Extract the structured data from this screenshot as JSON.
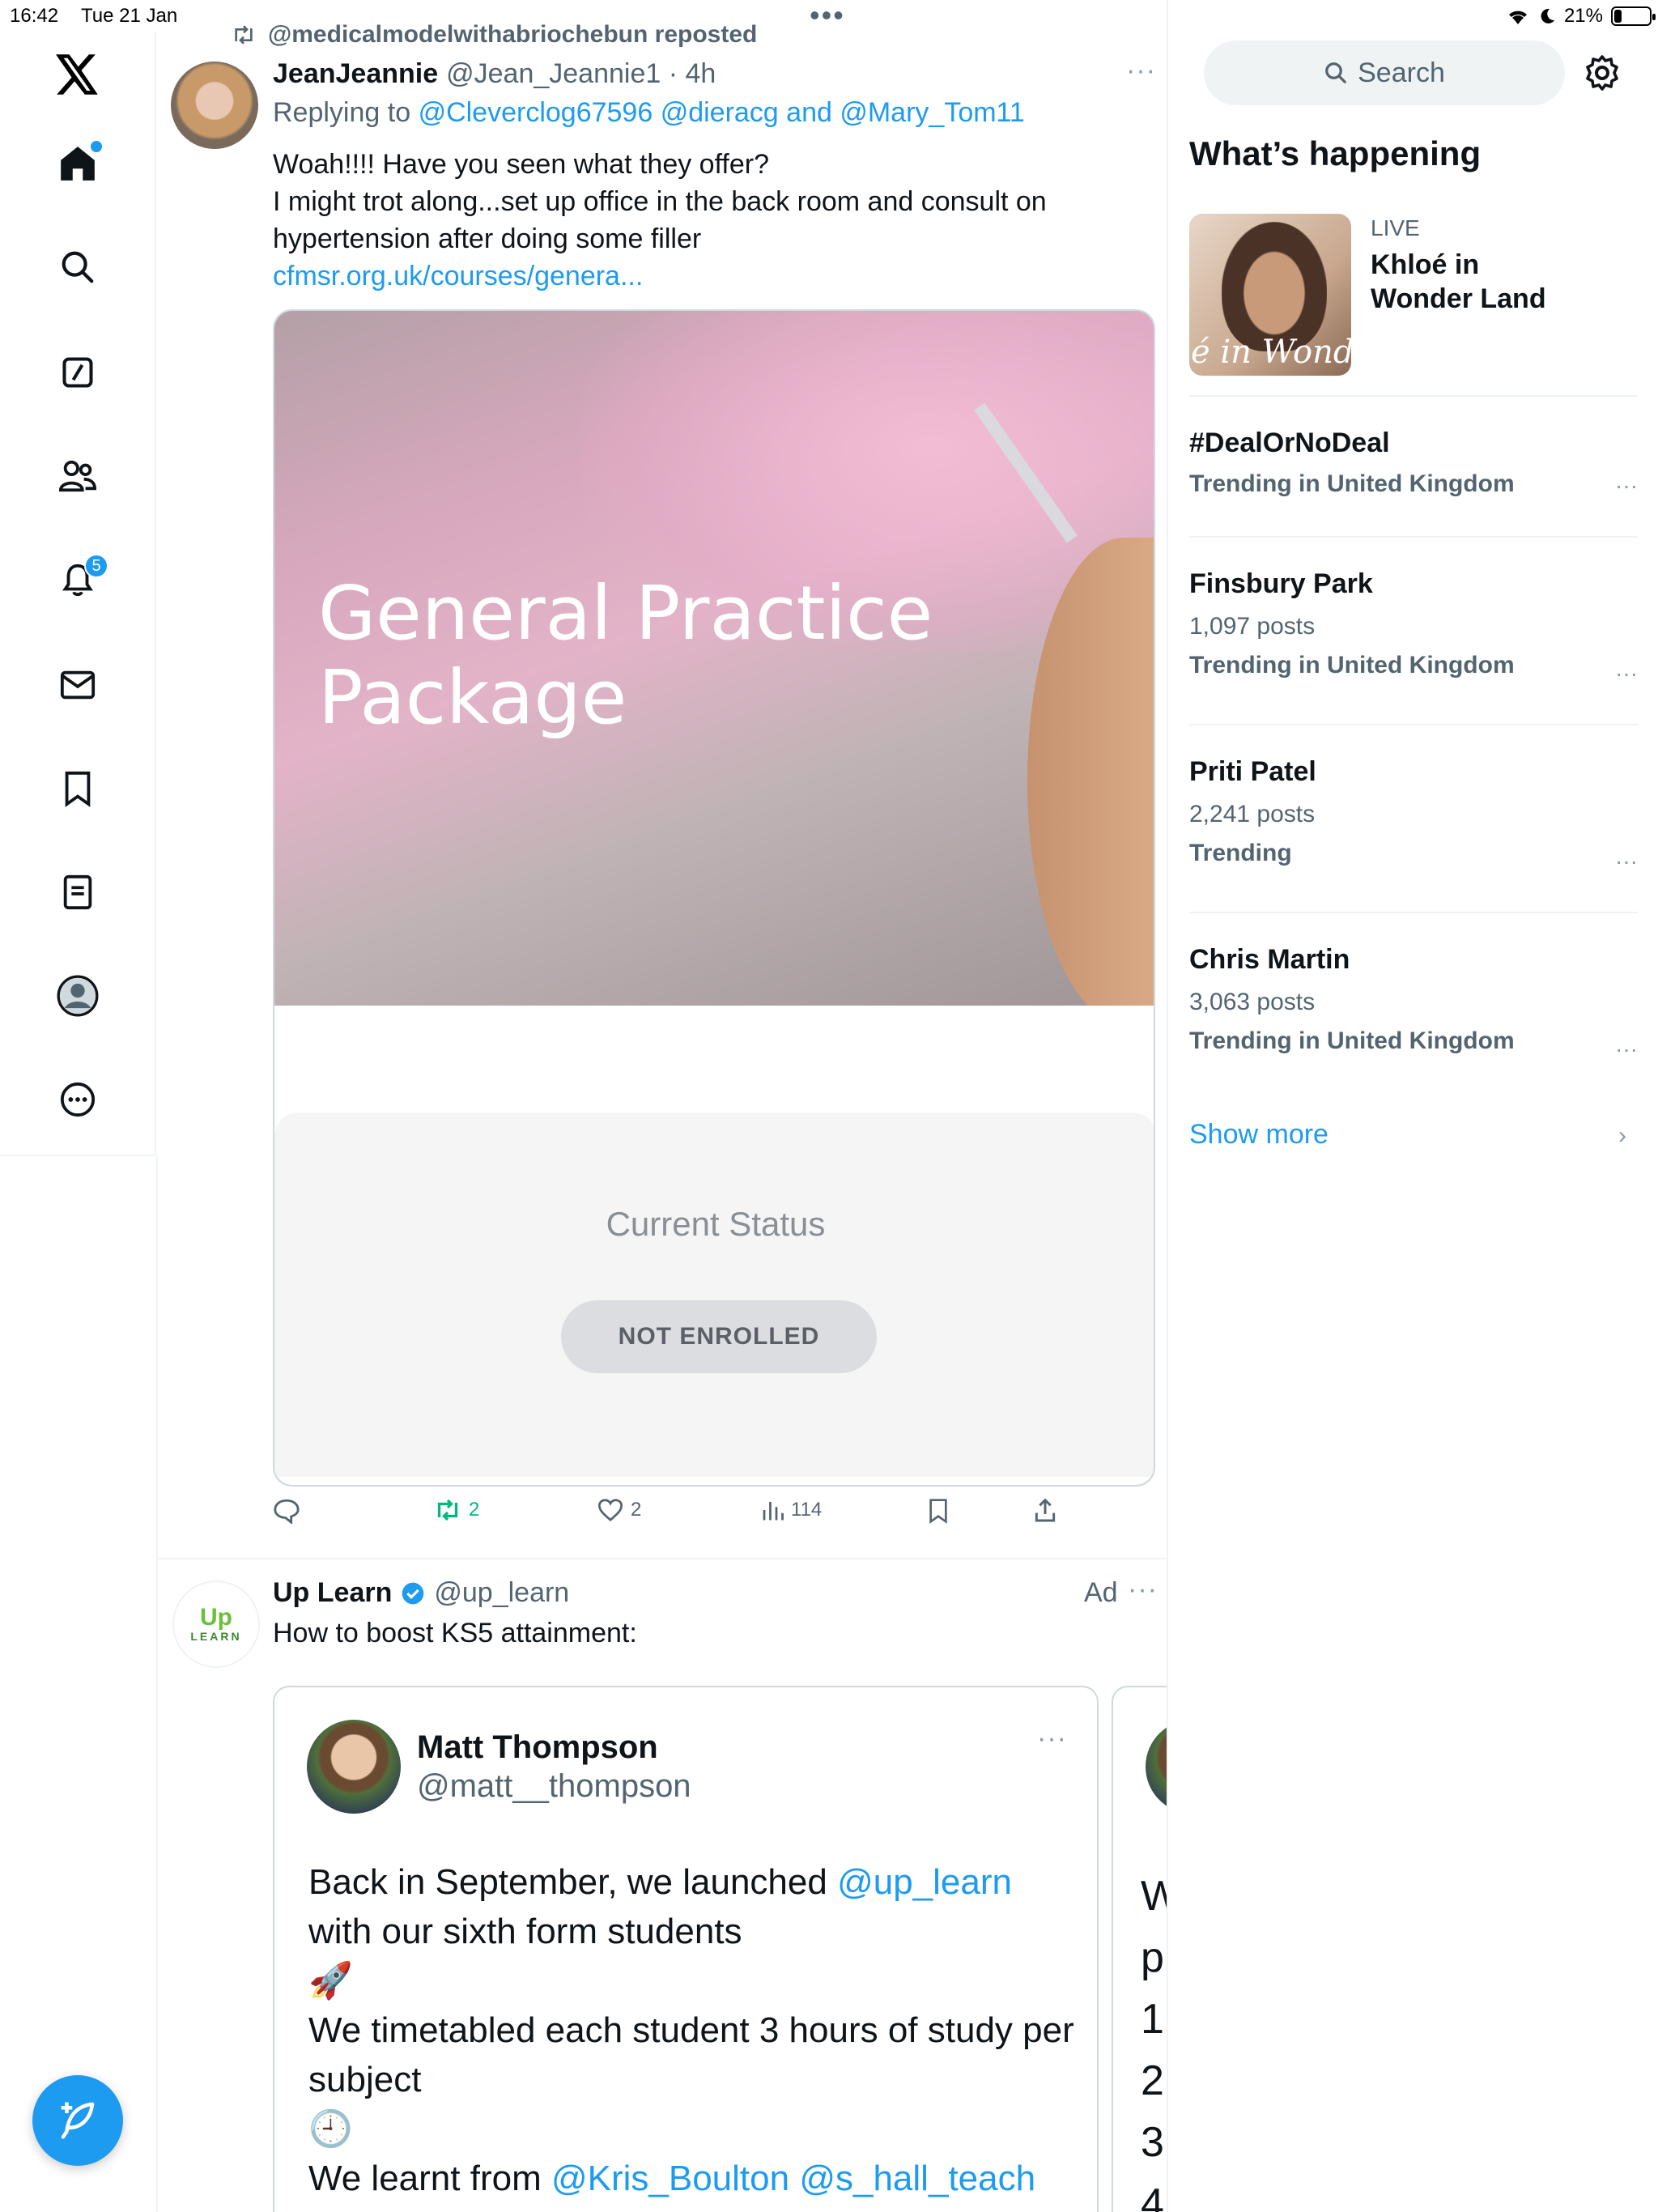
{
  "status_bar": {
    "time": "16:42",
    "date": "Tue 21 Jan",
    "battery": "21%",
    "battery_level": 0.21
  },
  "nav": {
    "notifications_badge": "5"
  },
  "post": {
    "repost_label": "@medicalmodelwithabriochebun reposted",
    "name": "JeanJeannie",
    "handle_time": "@Jean_Jeannie1 · 4h",
    "reply_prefix": "Replying to",
    "reply_handles": "@Cleverclog67596 @dieracg and @Mary_Tom11",
    "text_line1": "Woah!!!! Have you seen what they offer?",
    "text_line2": "I might trot along...set up office in the back room and consult on hypertension after doing some filler",
    "link": "cfmsr.org.uk/courses/genera...",
    "media_title_1": "General Practice",
    "media_title_2": "Package",
    "status_label": "Current Status",
    "status_pill": "NOT ENROLLED",
    "stats": {
      "retweets": "2",
      "likes": "2",
      "views": "114"
    }
  },
  "ad": {
    "name": "Up Learn",
    "handle": "@up_learn",
    "ad_label": "Ad",
    "text": "How to boost KS5 attainment:",
    "logo_top": "Up",
    "logo_bottom": "LEARN",
    "card": {
      "name": "Matt Thompson",
      "handle": "@matt__thompson",
      "line1_prefix": "Back in September, we launched ",
      "line1_mention": "@up_learn",
      "line2": "with our sixth form students",
      "emoji1": "🚀",
      "line3": "We timetabled each student 3 hours of study per subject",
      "emoji2": "🕘",
      "line4_prefix": "We learnt from ",
      "line4_mentions": "@Kris_Boulton @s_hall_teach"
    },
    "card2_lines": [
      "W",
      "p",
      "1.",
      "2",
      "3",
      "4"
    ]
  },
  "sidebar": {
    "search_placeholder": "Search",
    "title": "What’s happening",
    "live": {
      "label": "LIVE",
      "name": "Khloé in Wonder Land",
      "thumb_caption": "é in Wonder L"
    },
    "trends": [
      {
        "name": "#DealOrNoDeal",
        "sub": "",
        "context": "Trending in United Kingdom"
      },
      {
        "name": "Finsbury Park",
        "sub": "1,097 posts",
        "context": "Trending in United Kingdom"
      },
      {
        "name": "Priti Patel",
        "sub": "2,241 posts",
        "context": "Trending"
      },
      {
        "name": "Chris Martin",
        "sub": "3,063 posts",
        "context": "Trending in United Kingdom"
      }
    ],
    "show_more": "Show more"
  },
  "colors": {
    "accent": "#1d9bf0",
    "retweet_green": "#00ba7c",
    "text": "#0f1419",
    "muted": "#536471"
  }
}
